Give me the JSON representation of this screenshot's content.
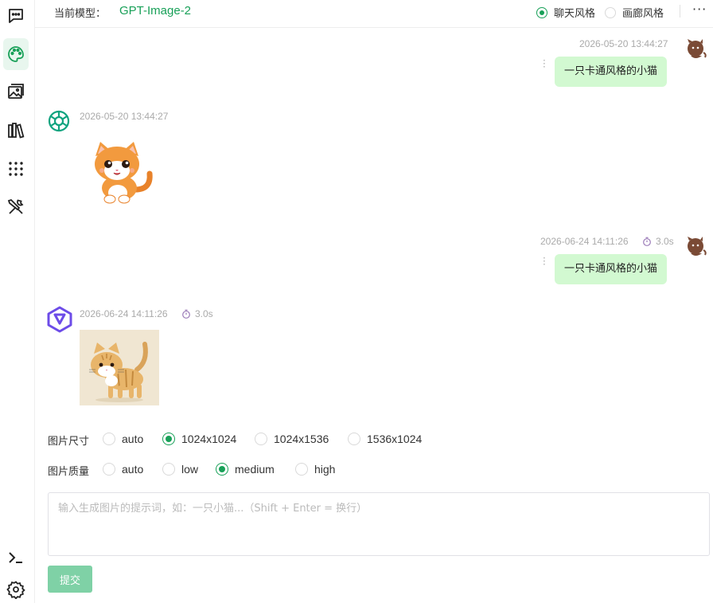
{
  "header": {
    "model_label": "当前模型：",
    "model_name": "GPT-Image-2",
    "style_options": [
      {
        "label": "聊天风格",
        "checked": true
      },
      {
        "label": "画廊风格",
        "checked": false
      }
    ],
    "more_label": "···"
  },
  "sidebar": {
    "items": [
      {
        "icon": "chat-icon",
        "active": false
      },
      {
        "icon": "palette-icon",
        "active": true
      },
      {
        "icon": "gallery-icon",
        "active": false
      },
      {
        "icon": "library-icon",
        "active": false
      },
      {
        "icon": "apps-grid-icon",
        "active": false
      },
      {
        "icon": "tools-icon",
        "active": false
      }
    ],
    "bottom_items": [
      {
        "icon": "terminal-icon"
      },
      {
        "icon": "settings-icon"
      }
    ]
  },
  "messages": [
    {
      "role": "user",
      "timestamp": "2026-05-20 13:44:27",
      "text": "一只卡通风格的小猫"
    },
    {
      "role": "assistant",
      "timestamp": "2026-05-20 13:44:27",
      "image": "cartoon-kitten-orange"
    },
    {
      "role": "user",
      "timestamp": "2026-06-24 14:11:26",
      "duration": "3.0s",
      "text": "一只卡通风格的小猫"
    },
    {
      "role": "assistant",
      "timestamp": "2026-06-24 14:11:26",
      "duration": "3.0s",
      "image": "cartoon-kitten-tabby"
    }
  ],
  "options": {
    "size": {
      "label": "图片尺寸",
      "choices": [
        "auto",
        "1024x1024",
        "1024x1536",
        "1536x1024"
      ],
      "selected": "1024x1024"
    },
    "quality": {
      "label": "图片质量",
      "choices": [
        "auto",
        "low",
        "medium",
        "high"
      ],
      "selected": "medium"
    }
  },
  "input": {
    "placeholder": "输入生成图片的提示词，如：一只小猫...（Shift + Enter = 换行）",
    "value": ""
  },
  "submit_label": "提交",
  "colors": {
    "accent": "#18a058",
    "bubble": "#d2f9d1",
    "submit": "#7fd1a6"
  }
}
